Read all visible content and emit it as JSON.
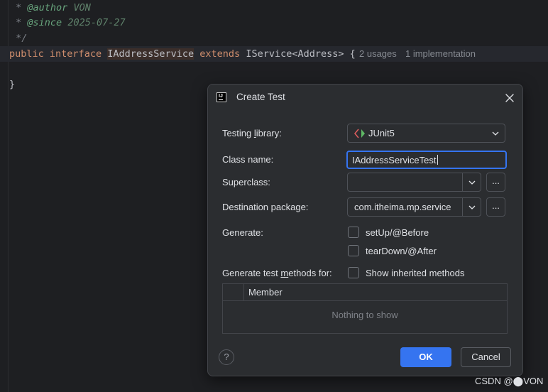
{
  "editor": {
    "comment_author_tag": "@author",
    "comment_author_value": "VON",
    "comment_since_tag": "@since",
    "comment_since_value": "2025-07-27",
    "comment_end": "*/",
    "kw_public": "public",
    "kw_interface": "interface",
    "interface_name": "IAddressService",
    "kw_extends": "extends",
    "super_type": "IService<Address> {",
    "usages_hint": "2 usages",
    "impl_hint": "1 implementation",
    "closing_brace": "}"
  },
  "dialog": {
    "title": "Create Test",
    "testing_library_label_pre": "Testing ",
    "testing_library_label_mnemonic": "l",
    "testing_library_label_post": "ibrary:",
    "testing_library_value": "JUnit5",
    "class_name_label": "Class name:",
    "class_name_value": "IAddressServiceTest",
    "superclass_label": "Superclass:",
    "superclass_value": "",
    "superclass_browse": "...",
    "destination_label": "Destination package:",
    "destination_value": "com.itheima.mp.service",
    "destination_browse": "...",
    "generate_label": "Generate:",
    "setup_label": "setUp/@Before",
    "teardown_label": "tearDown/@After",
    "methods_label_pre": "Generate test ",
    "methods_label_mnemonic": "m",
    "methods_label_post": "ethods for:",
    "inherited_label": "Show inherited methods",
    "table_header_member": "Member",
    "table_empty": "Nothing to show",
    "help_label": "?",
    "ok_label": "OK",
    "cancel_label": "Cancel"
  },
  "watermark": "CSDN @⬤VON",
  "colors": {
    "accent": "#3574f0",
    "keyword": "#cf8e6d",
    "comment_tag": "#67a37c"
  }
}
